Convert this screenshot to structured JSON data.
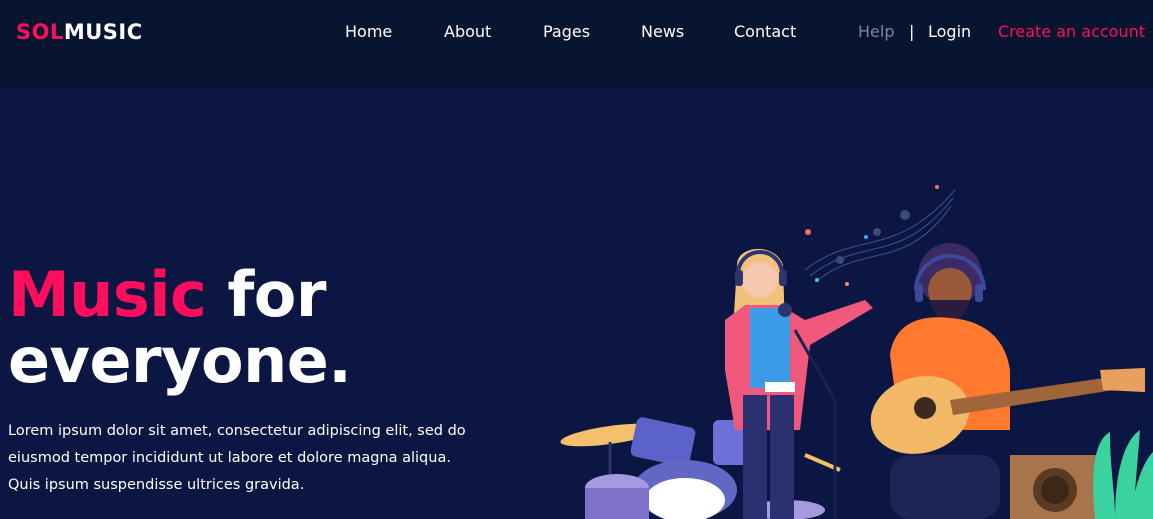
{
  "brand": {
    "accent": "SOL",
    "main": "MUSIC"
  },
  "nav": {
    "items": [
      "Home",
      "About",
      "Pages",
      "News",
      "Contact"
    ],
    "help": "Help",
    "separator": "|",
    "login": "Login",
    "create_account": "Create an account"
  },
  "hero": {
    "title_accent": "Music",
    "title_rest": " for",
    "title_line2": "everyone.",
    "description": "Lorem ipsum dolor sit amet, consectetur adipiscing elit, sed do eiusmod tempor incididunt ut labore et dolore magna aliqua. Quis ipsum suspendisse ultrices gravida."
  },
  "colors": {
    "accent": "#fe0e5c",
    "header_bg": "#081530",
    "page_bg": "#0b1742"
  }
}
